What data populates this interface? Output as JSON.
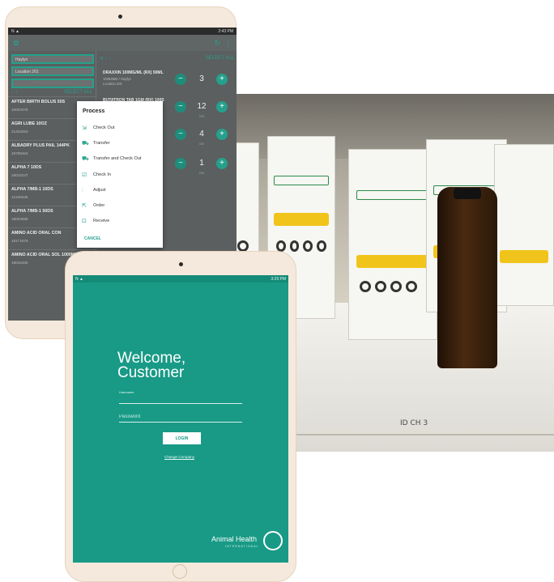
{
  "colors": {
    "teal": "#189a86",
    "accent": "#25a08c",
    "bezel": "#f4e9dc"
  },
  "photo": {
    "shelf_tag": "ID CH 3"
  },
  "back_tablet": {
    "status_bar": {
      "left_icons": "N ▲",
      "right": "2:43 PM"
    },
    "filters": {
      "user": "Haylyn",
      "location": "Location 201",
      "search_placeholder": "Enter Search Number"
    },
    "left_list": {
      "sort_icons": "↑ ↓",
      "select_all": "SELECT ALL",
      "items": [
        {
          "name": "AFTER BIRTH BOLUS 50S",
          "code": "10003475",
          "status": "ON"
        },
        {
          "name": "AGRI LUBE 10OZ",
          "code": "21263253",
          "status": "ON"
        },
        {
          "name": "ALBADRY PLUS PAIL 144PK",
          "code": "18789464",
          "status": "ON"
        },
        {
          "name": "ALPHA 7 10DS",
          "code": "18015247",
          "status": "ON"
        },
        {
          "name": "ALPHA 7/MB-1 10DS",
          "code": "12108436",
          "status": "ON"
        },
        {
          "name": "ALPHA 7/MB-1 50DS",
          "code": "18004698",
          "status": "ON"
        },
        {
          "name": "AMINO ACID ORAL CON",
          "code": "18171676",
          "status": ""
        },
        {
          "name": "AMINO ACID ORAL SOL 1000ML",
          "code": "18016425",
          "status": ""
        }
      ]
    },
    "right_list": {
      "toolbar_icons": "✕ ↑ ↓",
      "select_all": "SELECT ALL",
      "rows": [
        {
          "name": "DRAXXIN 100MG/ML (RX) 50ML",
          "sub1": "10084683 / Haylyn",
          "sub2": "Location 201",
          "qty": "3",
          "qsub": ""
        },
        {
          "name": "BUTATRON TAB 1GM (RX) 100S",
          "sub1": "",
          "sub2": "",
          "qty": "12",
          "qsub": "ON"
        },
        {
          "name": "",
          "sub1": "",
          "sub2": "",
          "qty": "4",
          "qsub": "ON"
        },
        {
          "name": "",
          "sub1": "",
          "sub2": "",
          "qty": "1",
          "qsub": "ON"
        }
      ]
    },
    "dialog": {
      "title": "Process",
      "options": [
        {
          "label": "Check Out",
          "icon": "cart-out-icon",
          "glyph": "⇲"
        },
        {
          "label": "Transfer",
          "icon": "truck-icon",
          "glyph": "⛟"
        },
        {
          "label": "Transfer and Check Out",
          "icon": "truck-out-icon",
          "glyph": "⛟"
        },
        {
          "label": "Check In",
          "icon": "check-in-icon",
          "glyph": "☑"
        },
        {
          "label": "Adjust",
          "icon": "sliders-icon",
          "glyph": "⫶"
        },
        {
          "label": "Order",
          "icon": "cart-icon",
          "glyph": "⇱"
        },
        {
          "label": "Receive",
          "icon": "receive-icon",
          "glyph": "⊡"
        }
      ],
      "cancel": "CANCEL"
    }
  },
  "front_tablet": {
    "status_bar": {
      "left_icons": "N ▲",
      "right": "3:29 PM"
    },
    "welcome_line1": "Welcome,",
    "welcome_line2": "Customer",
    "username_label": "Username",
    "username_value": "",
    "password_placeholder": "Password",
    "login_label": "LOGIN",
    "change_company": "Change Company",
    "brand_name": "Animal Health",
    "brand_sub": "INTERNATIONAL"
  }
}
